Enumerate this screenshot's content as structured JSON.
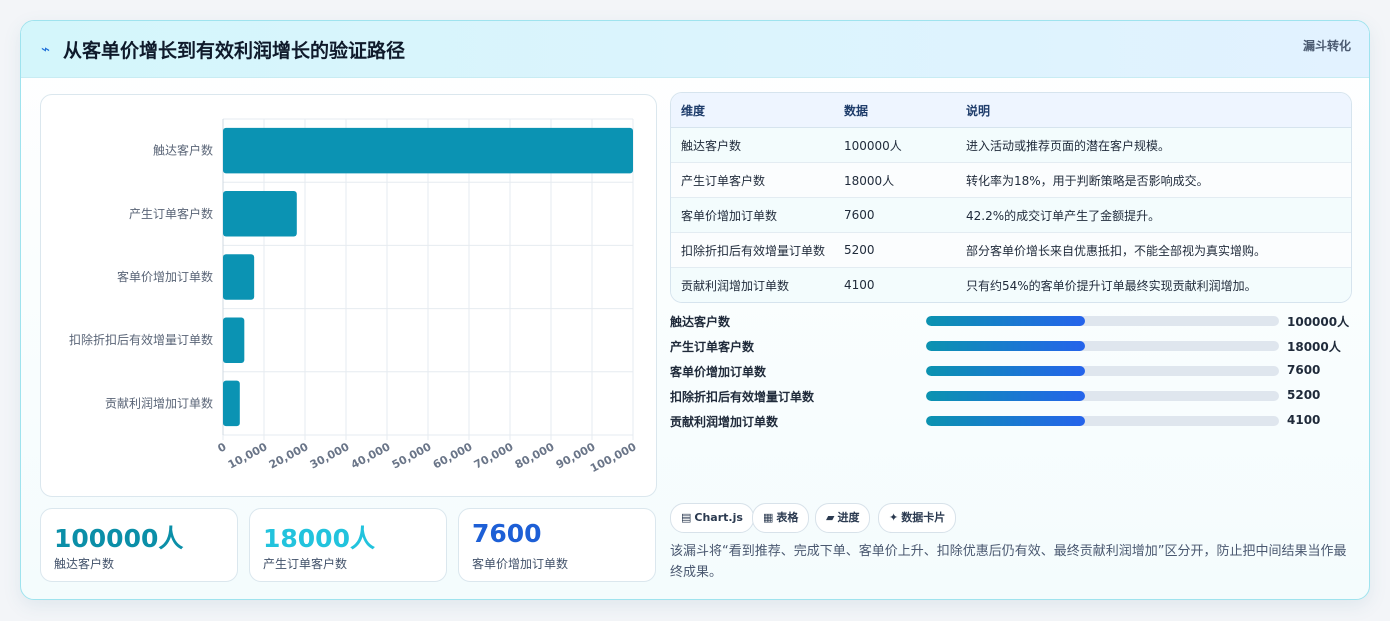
{
  "header": {
    "title": "从客单价增长到有效利润增长的验证路径",
    "tag": "漏斗转化"
  },
  "chart_data": {
    "type": "bar",
    "orientation": "horizontal",
    "categories": [
      "触达客户数",
      "产生订单客户数",
      "客单价增加订单数",
      "扣除折扣后有效增量订单数",
      "贡献利润增加订单数"
    ],
    "values": [
      100000,
      18000,
      7600,
      5200,
      4100
    ],
    "xlim": [
      0,
      100000
    ],
    "x_ticks": [
      "0",
      "10,000",
      "20,000",
      "30,000",
      "40,000",
      "50,000",
      "60,000",
      "70,000",
      "80,000",
      "90,000",
      "100,000"
    ],
    "grid": true,
    "bar_color": "#0b93b3"
  },
  "kpis": [
    {
      "value": "100000人",
      "label": "触达客户数",
      "color": "#0b8fa8"
    },
    {
      "value": "18000人",
      "label": "产生订单客户数",
      "color": "#22c3dd"
    },
    {
      "value": "7600",
      "label": "客单价增加订单数",
      "color": "#1d5fd6"
    }
  ],
  "table": {
    "headers": [
      "维度",
      "数据",
      "说明"
    ],
    "rows": [
      [
        "触达客户数",
        "100000人",
        "进入活动或推荐页面的潜在客户规模。"
      ],
      [
        "产生订单客户数",
        "18000人",
        "转化率为18%，用于判断策略是否影响成交。"
      ],
      [
        "客单价增加订单数",
        "7600",
        "42.2%的成交订单产生了金额提升。"
      ],
      [
        "扣除折扣后有效增量订单数",
        "5200",
        "部分客单价增长来自优惠抵扣，不能全部视为真实增购。"
      ],
      [
        "贡献利润增加订单数",
        "4100",
        "只有约54%的客单价提升订单最终实现贡献利润增加。"
      ]
    ]
  },
  "progress": [
    {
      "label": "触达客户数",
      "value": "100000人",
      "fill": 0.45
    },
    {
      "label": "产生订单客户数",
      "value": "18000人",
      "fill": 0.45
    },
    {
      "label": "客单价增加订单数",
      "value": "7600",
      "fill": 0.45
    },
    {
      "label": "扣除折扣后有效增量订单数",
      "value": "5200",
      "fill": 0.45
    },
    {
      "label": "贡献利润增加订单数",
      "value": "4100",
      "fill": 0.45
    }
  ],
  "pills": [
    {
      "icon": "chart-icon",
      "glyph": "▤",
      "label": "Chart.js"
    },
    {
      "icon": "table-icon",
      "glyph": "▦",
      "label": "表格"
    },
    {
      "icon": "progress-icon",
      "glyph": "▰",
      "label": "进度"
    },
    {
      "icon": "sparkle-icon",
      "glyph": "✦",
      "label": "数据卡片"
    }
  ],
  "note": "该漏斗将“看到推荐、完成下单、客单价上升、扣除优惠后仍有效、最终贡献利润增加”区分开，防止把中间结果当作最终成果。"
}
